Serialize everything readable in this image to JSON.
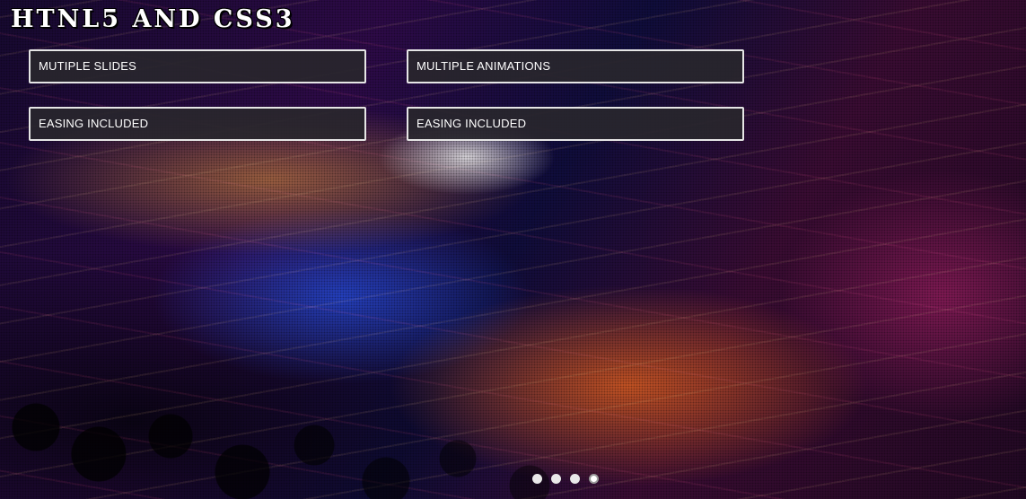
{
  "slider": {
    "title": "HTNL5 AND CSS3",
    "features": [
      {
        "label": "MUTIPLE SLIDES"
      },
      {
        "label": "MULTIPLE ANIMATIONS"
      },
      {
        "label": "EASING INCLUDED"
      },
      {
        "label": "EASING INCLUDED"
      }
    ],
    "pagination": {
      "count": 4,
      "active_index": 4
    }
  },
  "colors": {
    "box_background": "#28262c",
    "box_border": "#e6e6e6",
    "text": "#ffffff",
    "pager_dot": "#e9e9e9"
  }
}
